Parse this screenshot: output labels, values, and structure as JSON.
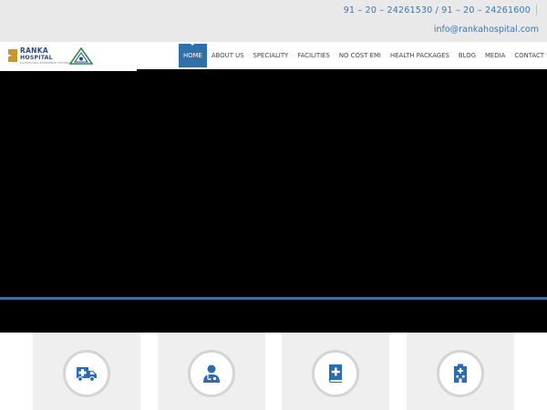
{
  "header": {
    "phones": "91 – 20 – 24261530 / 91 – 20 – 24261600",
    "email": "info@rankahospital.com"
  },
  "logo": {
    "line1": "RANKA",
    "line2": "HOSPITAL",
    "tagline": "EXCEPTIONAL EXPERIENCE MATTERS"
  },
  "nav": {
    "items": [
      {
        "label": "HOME",
        "active": true
      },
      {
        "label": "ABOUT US"
      },
      {
        "label": "SPECIALITY"
      },
      {
        "label": "FACILITIES"
      },
      {
        "label": "NO COST EMI"
      },
      {
        "label": "HEALTH PACKAGES"
      },
      {
        "label": "BLOG"
      },
      {
        "label": "MEDIA"
      },
      {
        "label": "CONTACT US"
      }
    ]
  },
  "features": {
    "cards": [
      {
        "icon": "ambulance-icon"
      },
      {
        "icon": "doctor-icon"
      },
      {
        "icon": "medical-book-icon"
      },
      {
        "icon": "hospital-building-icon"
      }
    ]
  },
  "colors": {
    "accent": "#2f6fab",
    "link": "#3a78b0",
    "topbar": "#e9e9e9",
    "hero": "#000000",
    "hero_line": "#3d6ea6",
    "card": "#efefef",
    "icon": "#2c6db0"
  }
}
